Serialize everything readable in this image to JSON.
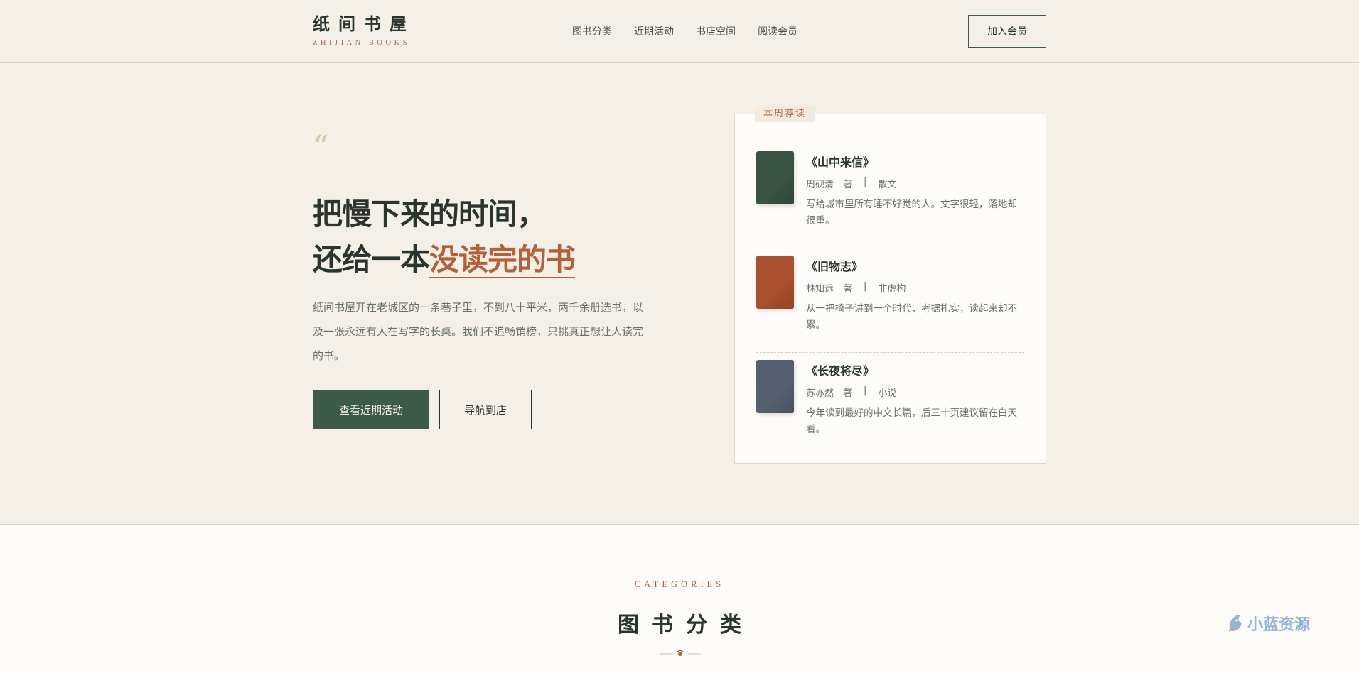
{
  "brand": {
    "name_cn": "纸间书屋",
    "name_en": "ZHIJIAN BOOKS"
  },
  "nav": {
    "items": [
      {
        "label": "图书分类"
      },
      {
        "label": "近期活动"
      },
      {
        "label": "书店空间"
      },
      {
        "label": "阅读会员"
      }
    ],
    "join_label": "加入会员"
  },
  "hero": {
    "quote_mark": "“",
    "title_line1": "把慢下来的时间，",
    "title_line2_prefix": "还给一本",
    "title_line2_highlight": "没读完的书",
    "description": "纸间书屋开在老城区的一条巷子里，不到八十平米，两千余册选书，以及一张永远有人在写字的长桌。我们不追畅销榜，只挑真正想让人读完的书。",
    "primary_button": "查看近期活动",
    "secondary_button": "导航到店"
  },
  "recommend": {
    "tag": "本周荐读",
    "books": [
      {
        "title": "《山中来信》",
        "author": "周砚清",
        "by": "著",
        "sep": "|",
        "genre": "散文",
        "desc": "写给城市里所有睡不好觉的人。文字很轻，落地却很重。",
        "cover_color": "#3a5242"
      },
      {
        "title": "《旧物志》",
        "author": "林知远",
        "by": "著",
        "sep": "|",
        "genre": "非虚构",
        "desc": "从一把椅子讲到一个时代，考据扎实，读起来却不累。",
        "cover_color": "#a9502e"
      },
      {
        "title": "《长夜将尽》",
        "author": "苏亦然",
        "by": "著",
        "sep": "|",
        "genre": "小说",
        "desc": "今年读到最好的中文长篇，后三十页建议留在白天看。",
        "cover_color": "#56606f"
      }
    ]
  },
  "categories": {
    "eyebrow": "CATEGORIES",
    "title": "图书分类"
  },
  "watermark": {
    "text": "小蓝资源"
  },
  "colors": {
    "background": "#f4f0e7",
    "accent_green": "#3d5a4a",
    "accent_orange": "#b5603a",
    "text_dark": "#2b3530"
  }
}
